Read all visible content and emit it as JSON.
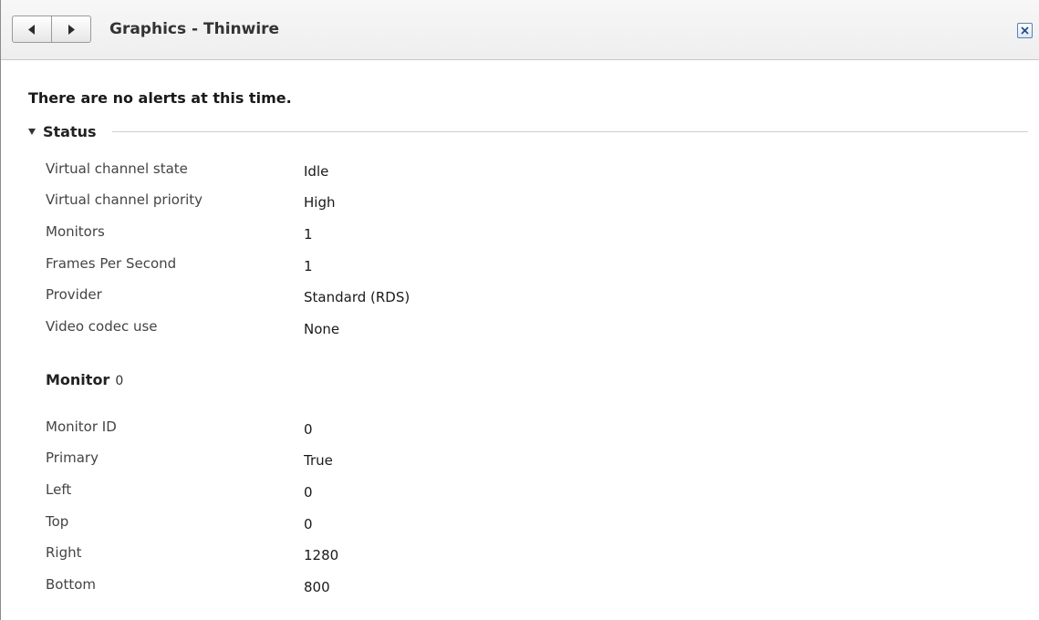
{
  "header": {
    "title": "Graphics - Thinwire",
    "back_icon": "chevron-left-icon",
    "forward_icon": "chevron-right-icon",
    "close_icon": "close-icon"
  },
  "alerts": {
    "message": "There are no alerts at this time."
  },
  "status": {
    "title": "Status",
    "rows": [
      {
        "label": "Virtual channel state",
        "value": "Idle"
      },
      {
        "label": "Virtual channel priority",
        "value": "High"
      },
      {
        "label": "Monitors",
        "value": "1"
      },
      {
        "label": "Frames Per Second",
        "value": "1"
      },
      {
        "label": "Provider",
        "value": "Standard (RDS)"
      },
      {
        "label": "Video codec use",
        "value": "None"
      }
    ]
  },
  "monitor": {
    "title": "Monitor",
    "index": "0",
    "rows": [
      {
        "label": "Monitor ID",
        "value": "0"
      },
      {
        "label": "Primary",
        "value": "True"
      },
      {
        "label": "Left",
        "value": "0"
      },
      {
        "label": "Top",
        "value": "0"
      },
      {
        "label": "Right",
        "value": "1280"
      },
      {
        "label": "Bottom",
        "value": "800"
      }
    ]
  }
}
